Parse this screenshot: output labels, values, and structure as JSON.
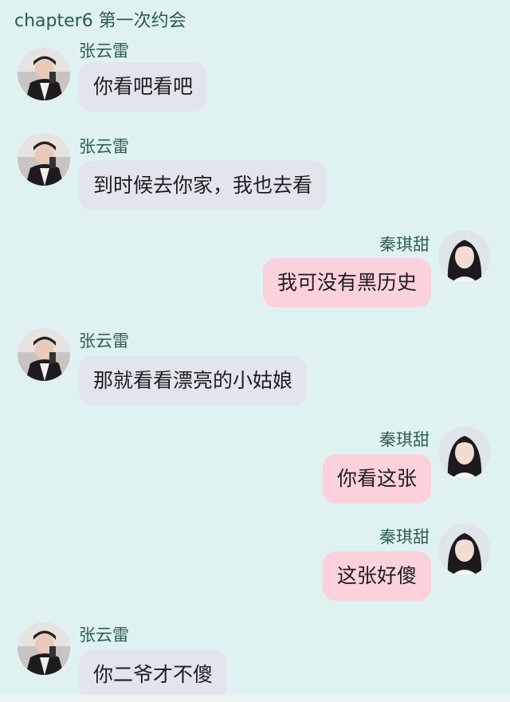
{
  "header": {
    "title": "chapter6 第一次约会"
  },
  "colors": {
    "background": "#dff2f1",
    "left_bubble": "#e2e5ee",
    "right_bubble": "#fbd2dc",
    "name_text": "#2f5e56"
  },
  "messages": [
    {
      "sender": "张云雷",
      "side": "left",
      "text": "你看吧看吧"
    },
    {
      "sender": "张云雷",
      "side": "left",
      "text": "到时候去你家，我也去看"
    },
    {
      "sender": "秦琪甜",
      "side": "right",
      "text": "我可没有黑历史"
    },
    {
      "sender": "张云雷",
      "side": "left",
      "text": "那就看看漂亮的小姑娘"
    },
    {
      "sender": "秦琪甜",
      "side": "right",
      "text": "你看这张"
    },
    {
      "sender": "秦琪甜",
      "side": "right",
      "text": "这张好傻"
    },
    {
      "sender": "张云雷",
      "side": "left",
      "text": "你二爷才不傻"
    }
  ]
}
